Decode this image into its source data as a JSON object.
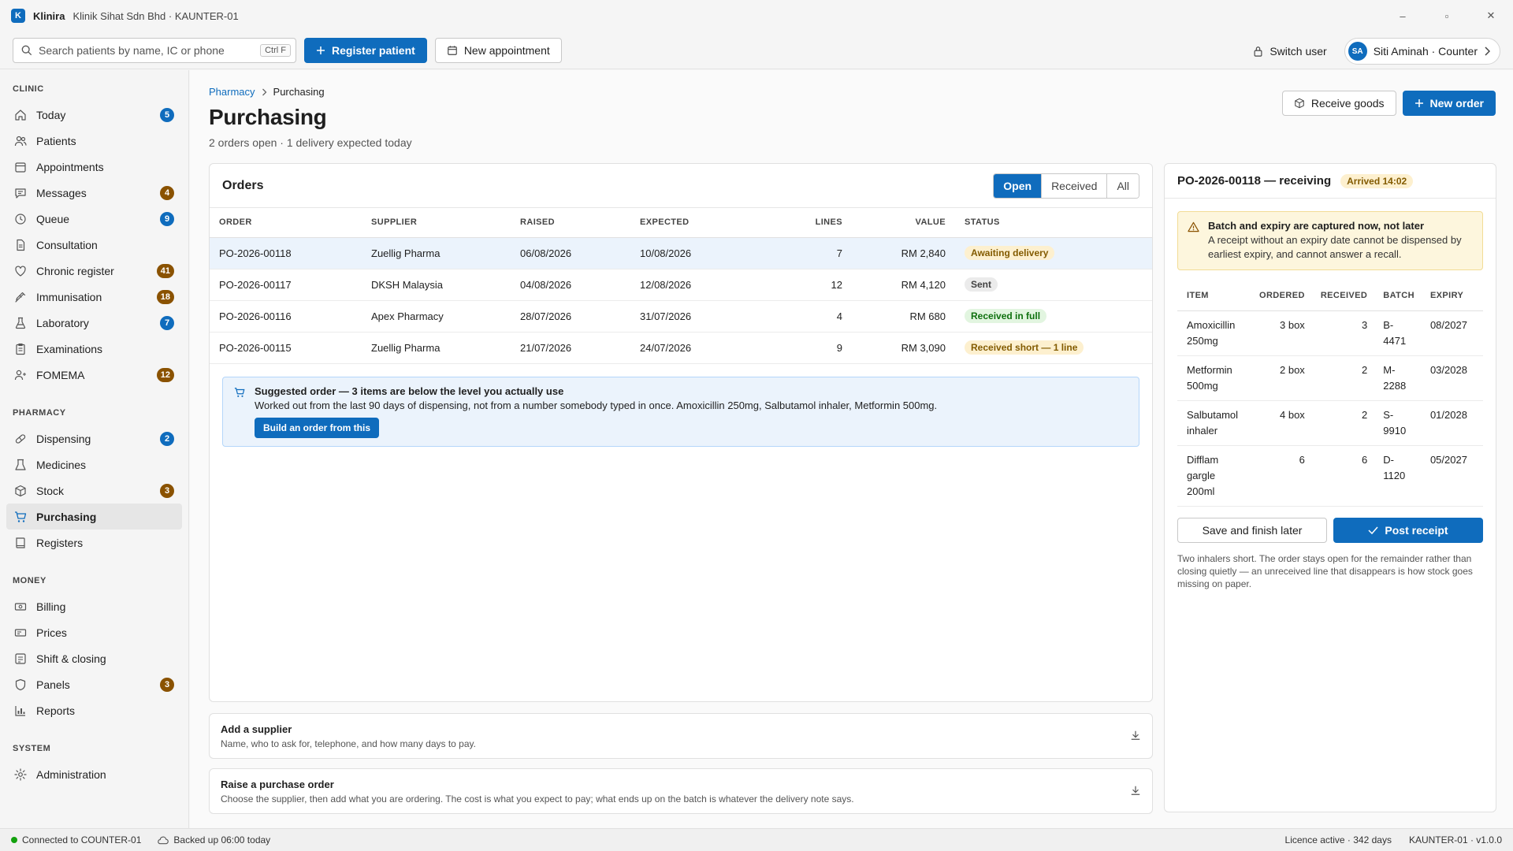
{
  "window": {
    "logo_letter": "K",
    "app_name": "Klinira",
    "subtitle": "Klinik Sihat Sdn Bhd · KAUNTER-01",
    "minimize": "–",
    "maximize": "▫",
    "close": "✕"
  },
  "toolbar": {
    "search_placeholder": "Search patients by name, IC or phone",
    "search_shortcut": "Ctrl F",
    "register_label": "Register patient",
    "appointment_label": "New appointment",
    "switch_user_label": "Switch user",
    "user_initials": "SA",
    "user_label": "Siti Aminah · Counter"
  },
  "sidebar": {
    "sections": [
      {
        "title": "CLINIC",
        "items": [
          {
            "label": "Today",
            "icon": "home-icon",
            "badge": "5",
            "badge_color": "#0f6cbd"
          },
          {
            "label": "Patients",
            "icon": "people-icon",
            "badge": "",
            "badge_color": ""
          },
          {
            "label": "Appointments",
            "icon": "calendar-icon",
            "badge": "",
            "badge_color": ""
          },
          {
            "label": "Messages",
            "icon": "chat-icon",
            "badge": "4",
            "badge_color": "#8a5200"
          },
          {
            "label": "Queue",
            "icon": "clock-icon",
            "badge": "9",
            "badge_color": "#0f6cbd"
          },
          {
            "label": "Consultation",
            "icon": "document-icon",
            "badge": "",
            "badge_color": ""
          },
          {
            "label": "Chronic register",
            "icon": "heart-icon",
            "badge": "41",
            "badge_color": "#8a5200"
          },
          {
            "label": "Immunisation",
            "icon": "syringe-icon",
            "badge": "18",
            "badge_color": "#8a5200"
          },
          {
            "label": "Laboratory",
            "icon": "flask-icon",
            "badge": "7",
            "badge_color": "#0f6cbd"
          },
          {
            "label": "Examinations",
            "icon": "clipboard-icon",
            "badge": "",
            "badge_color": ""
          },
          {
            "label": "FOMEMA",
            "icon": "person-icon",
            "badge": "12",
            "badge_color": "#8a5200"
          }
        ]
      },
      {
        "title": "PHARMACY",
        "items": [
          {
            "label": "Dispensing",
            "icon": "pill-icon",
            "badge": "2",
            "badge_color": "#0f6cbd"
          },
          {
            "label": "Medicines",
            "icon": "beaker-icon",
            "badge": "",
            "badge_color": ""
          },
          {
            "label": "Stock",
            "icon": "box-icon",
            "badge": "3",
            "badge_color": "#8a5200"
          },
          {
            "label": "Purchasing",
            "icon": "cart-icon",
            "badge": "",
            "badge_color": "",
            "active": true
          },
          {
            "label": "Registers",
            "icon": "book-icon",
            "badge": "",
            "badge_color": ""
          }
        ]
      },
      {
        "title": "MONEY",
        "items": [
          {
            "label": "Billing",
            "icon": "cash-icon",
            "badge": "",
            "badge_color": ""
          },
          {
            "label": "Prices",
            "icon": "tag-icon",
            "badge": "",
            "badge_color": ""
          },
          {
            "label": "Shift & closing",
            "icon": "register-icon",
            "badge": "",
            "badge_color": ""
          },
          {
            "label": "Panels",
            "icon": "shield-icon",
            "badge": "3",
            "badge_color": "#8a5200"
          },
          {
            "label": "Reports",
            "icon": "chart-icon",
            "badge": "",
            "badge_color": ""
          }
        ]
      },
      {
        "title": "SYSTEM",
        "items": [
          {
            "label": "Administration",
            "icon": "gear-icon",
            "badge": "",
            "badge_color": ""
          }
        ]
      }
    ]
  },
  "page": {
    "breadcrumb_parent": "Pharmacy",
    "breadcrumb_current": "Purchasing",
    "title": "Purchasing",
    "subtitle": "2 orders open · 1 delivery expected today",
    "receive_goods_label": "Receive goods",
    "new_order_label": "New order"
  },
  "orders": {
    "title": "Orders",
    "filters": [
      "Open",
      "Received",
      "All"
    ],
    "active_filter": 0,
    "columns": [
      "ORDER",
      "SUPPLIER",
      "RAISED",
      "EXPECTED",
      "LINES",
      "VALUE",
      "STATUS"
    ],
    "rows": [
      {
        "order": "PO-2026-00118",
        "supplier": "Zuellig Pharma",
        "raised": "06/08/2026",
        "expected": "10/08/2026",
        "lines": "7",
        "value": "RM 2,840",
        "status": "Awaiting delivery",
        "status_kind": "amber",
        "selected": true
      },
      {
        "order": "PO-2026-00117",
        "supplier": "DKSH Malaysia",
        "raised": "04/08/2026",
        "expected": "12/08/2026",
        "lines": "12",
        "value": "RM 4,120",
        "status": "Sent",
        "status_kind": "grey",
        "selected": false
      },
      {
        "order": "PO-2026-00116",
        "supplier": "Apex Pharmacy",
        "raised": "28/07/2026",
        "expected": "31/07/2026",
        "lines": "4",
        "value": "RM 680",
        "status": "Received in full",
        "status_kind": "green",
        "selected": false
      },
      {
        "order": "PO-2026-00115",
        "supplier": "Zuellig Pharma",
        "raised": "21/07/2026",
        "expected": "24/07/2026",
        "lines": "9",
        "value": "RM 3,090",
        "status": "Received short — 1 line",
        "status_kind": "amber",
        "selected": false
      }
    ],
    "suggest_title": "Suggested order — 3 items are below the level you actually use",
    "suggest_body": "Worked out from the last 90 days of dispensing, not from a number somebody typed in once. Amoxicillin 250mg, Salbutamol inhaler, Metformin 500mg.",
    "suggest_button": "Build an order from this"
  },
  "expanders": [
    {
      "title": "Add a supplier",
      "body": "Name, who to ask for, telephone, and how many days to pay."
    },
    {
      "title": "Raise a purchase order",
      "body": "Choose the supplier, then add what you are ordering. The cost is what you expect to pay; what ends up on the batch is whatever the delivery note says."
    }
  ],
  "receiving": {
    "title": "PO-2026-00118 — receiving",
    "badge": "Arrived 14:02",
    "warn_title": "Batch and expiry are captured now, not later",
    "warn_body": "A receipt without an expiry date cannot be dispensed by earliest expiry, and cannot answer a recall.",
    "columns": [
      "ITEM",
      "ORDERED",
      "RECEIVED",
      "BATCH",
      "EXPIRY"
    ],
    "rows": [
      {
        "item": "Amoxicillin 250mg",
        "ordered": "3 box",
        "received": "3",
        "batch": "B-4471",
        "expiry": "08/2027"
      },
      {
        "item": "Metformin 500mg",
        "ordered": "2 box",
        "received": "2",
        "batch": "M-2288",
        "expiry": "03/2028"
      },
      {
        "item": "Salbutamol inhaler",
        "ordered": "4 box",
        "received": "2",
        "batch": "S-9910",
        "expiry": "01/2028"
      },
      {
        "item": "Difflam gargle 200ml",
        "ordered": "6",
        "received": "6",
        "batch": "D-1120",
        "expiry": "05/2027"
      }
    ],
    "save_label": "Save and finish later",
    "post_label": "Post receipt",
    "note": "Two inhalers short. The order stays open for the remainder rather than closing quietly — an unreceived line that disappears is how stock goes missing on paper."
  },
  "status": {
    "connection": "Connected to COUNTER-01",
    "backup": "Backed up 06:00 today",
    "licence": "Licence active · 342 days",
    "version": "KAUNTER-01 · v1.0.0"
  }
}
